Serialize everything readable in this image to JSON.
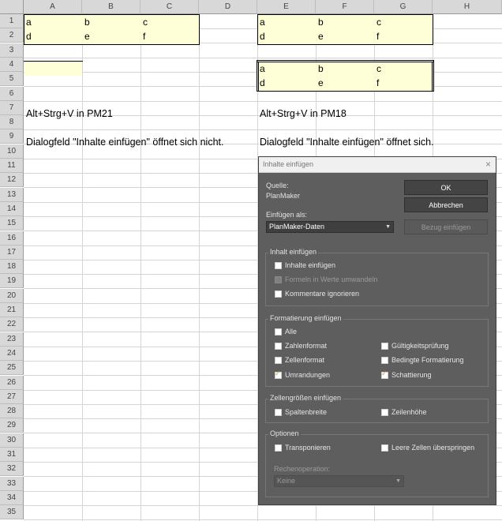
{
  "columns": [
    "A",
    "B",
    "C",
    "D",
    "E",
    "F",
    "G",
    "H"
  ],
  "rows": [
    "1",
    "2",
    "3",
    "4",
    "5",
    "6",
    "7",
    "8",
    "9",
    "10",
    "11",
    "12",
    "13",
    "14",
    "15",
    "16",
    "17",
    "18",
    "19",
    "20",
    "21",
    "22",
    "23",
    "24",
    "25",
    "26",
    "27",
    "28",
    "29",
    "30",
    "31",
    "32",
    "33",
    "34",
    "35"
  ],
  "left_block": {
    "row1": [
      "a",
      "b",
      "c"
    ],
    "row2": [
      "d",
      "e",
      "f"
    ]
  },
  "right_block_top": {
    "row1": [
      "a",
      "b",
      "c"
    ],
    "row2": [
      "d",
      "e",
      "f"
    ]
  },
  "right_block_bottom": {
    "row4": [
      "a",
      "b",
      "c"
    ],
    "row5": [
      "d",
      "e",
      "f"
    ]
  },
  "notes": {
    "left_shortcut": "Alt+Strg+V in PM21",
    "right_shortcut": "Alt+Strg+V in PM18",
    "left_result": "Dialogfeld \"Inhalte einfügen\" öffnet sich nicht.",
    "right_result": "Dialogfeld \"Inhalte einfügen\" öffnet sich."
  },
  "dialog": {
    "title": "Inhalte einfügen",
    "close": "×",
    "source_label": "Quelle:",
    "source_value": "PlanMaker",
    "paste_as_label": "Einfügen als:",
    "paste_as_value": "PlanMaker-Daten",
    "ok": "OK",
    "cancel": "Abbrechen",
    "link": "Bezug einfügen",
    "group_content": "Inhalt einfügen",
    "content_opts": [
      "Inhalte einfügen",
      "Formeln in Werte umwandeln",
      "Kommentare ignorieren"
    ],
    "group_format": "Formatierung einfügen",
    "format_all": "Alle",
    "format_left": [
      "Zahlenformat",
      "Zellenformat",
      "Umrandungen"
    ],
    "format_right": [
      "Gültigkeitsprüfung",
      "Bedingte Formatierung",
      "Schattierung"
    ],
    "group_sizes": "Zellengrößen einfügen",
    "sizes": [
      "Spaltenbreite",
      "Zeilenhöhe"
    ],
    "group_options": "Optionen",
    "options": [
      "Transponieren",
      "Leere Zellen überspringen"
    ],
    "calc_label": "Rechenoperation:",
    "calc_value": "Keine",
    "checked": [
      "Umrandungen",
      "Schattierung"
    ],
    "accent_check_color": "#d9a441"
  }
}
